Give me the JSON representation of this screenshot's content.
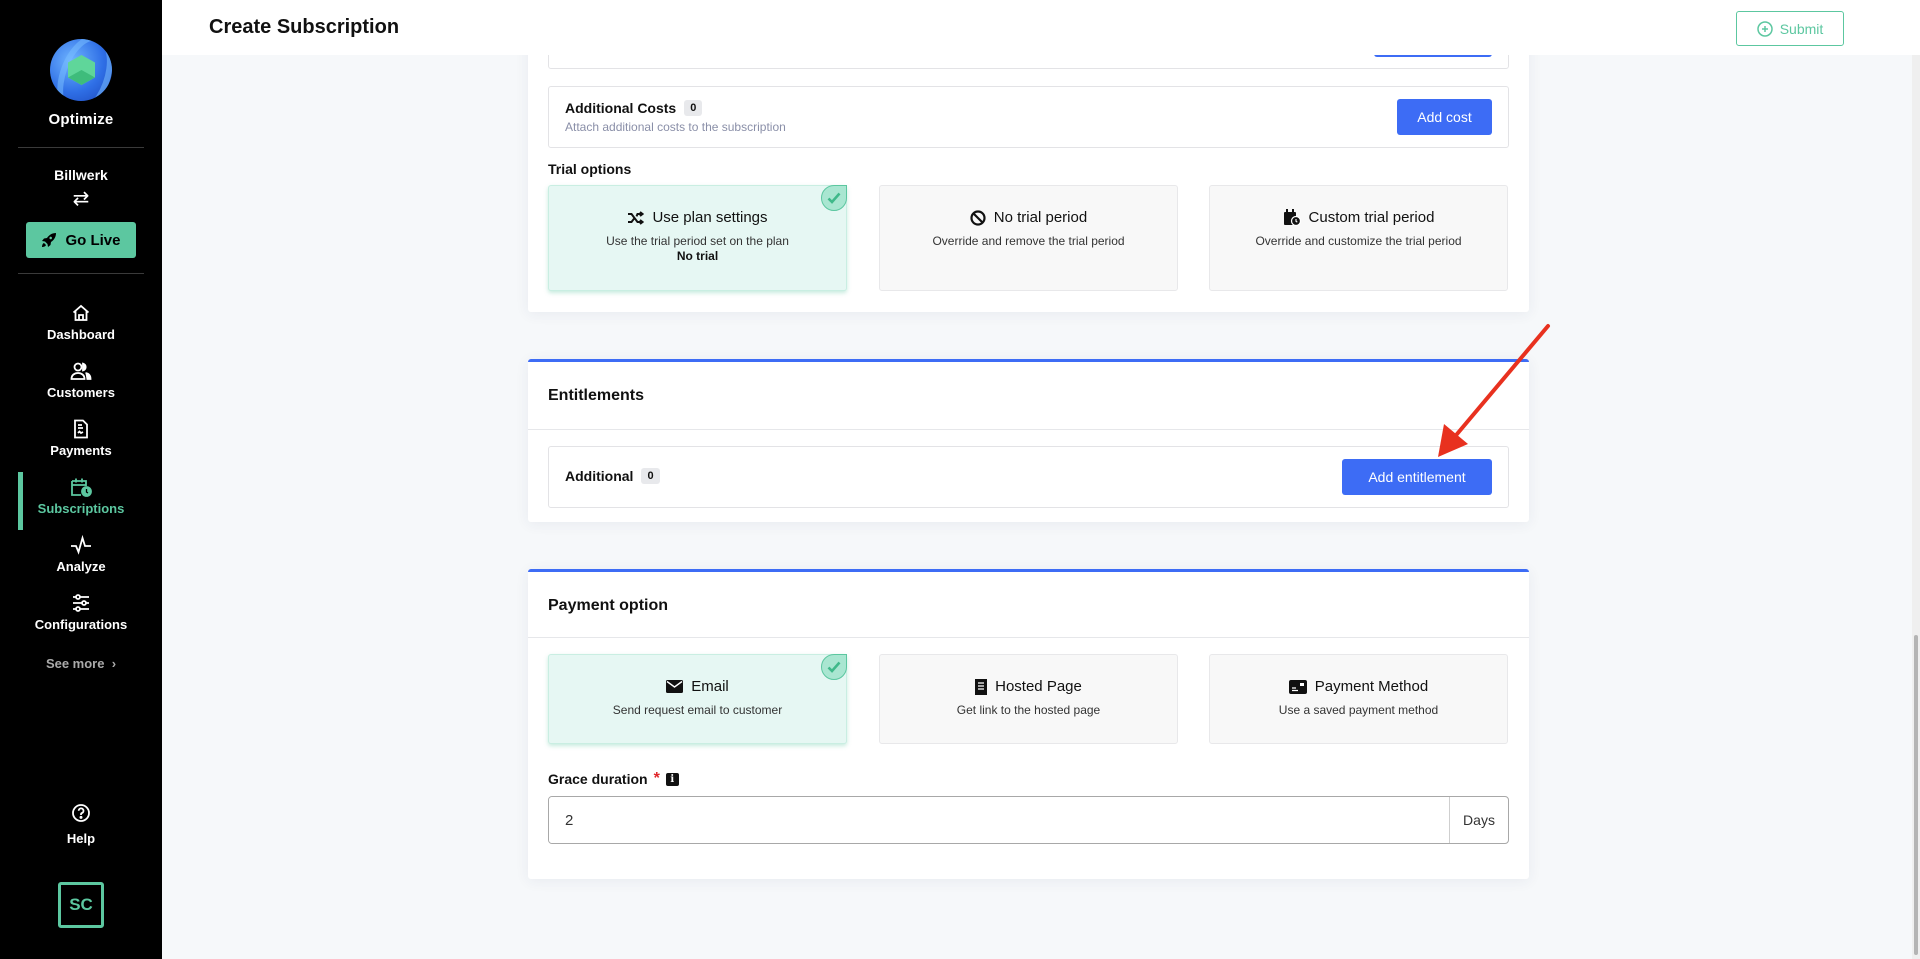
{
  "sidebar": {
    "brand": "Optimize",
    "environment": "Billwerk",
    "switch_icon": "swap-arrows-icon",
    "go_live_label": "Go Live",
    "items": [
      {
        "label": "Dashboard",
        "icon": "home-icon",
        "active": false
      },
      {
        "label": "Customers",
        "icon": "users-icon",
        "active": false
      },
      {
        "label": "Payments",
        "icon": "invoice-icon",
        "active": false
      },
      {
        "label": "Subscriptions",
        "icon": "calendar-clock-icon",
        "active": true
      },
      {
        "label": "Analyze",
        "icon": "pulse-icon",
        "active": false
      },
      {
        "label": "Configurations",
        "icon": "sliders-icon",
        "active": false
      }
    ],
    "see_more_label": "See more",
    "help_label": "Help",
    "avatar_initials": "SC"
  },
  "header": {
    "title": "Create Subscription",
    "submit_label": "Submit"
  },
  "additional_costs": {
    "title": "Additional Costs",
    "count": "0",
    "description": "Attach additional costs to the subscription",
    "button_label": "Add cost"
  },
  "trial_options": {
    "label": "Trial options",
    "options": [
      {
        "title": "Use plan settings",
        "icon": "shuffle-icon",
        "description": "Use the trial period set on the plan",
        "extra": "No trial",
        "selected": true
      },
      {
        "title": "No trial period",
        "icon": "ban-icon",
        "description": "Override and remove the trial period",
        "extra": "",
        "selected": false
      },
      {
        "title": "Custom trial period",
        "icon": "calendar-clock-icon",
        "description": "Override and customize the trial period",
        "extra": "",
        "selected": false
      }
    ]
  },
  "entitlements": {
    "title": "Entitlements",
    "row_label": "Additional",
    "count": "0",
    "button_label": "Add entitlement"
  },
  "payment_option": {
    "title": "Payment option",
    "options": [
      {
        "title": "Email",
        "icon": "envelope-icon",
        "description": "Send request email to customer",
        "selected": true
      },
      {
        "title": "Hosted Page",
        "icon": "receipt-icon",
        "description": "Get link to the hosted page",
        "selected": false
      },
      {
        "title": "Payment Method",
        "icon": "credit-card-icon",
        "description": "Use a saved payment method",
        "selected": false
      }
    ],
    "grace_duration": {
      "label": "Grace duration",
      "required_mark": "*",
      "value": "2",
      "unit": "Days"
    }
  },
  "colors": {
    "accent_green": "#5cc7a0",
    "primary_blue": "#3d6cf5",
    "annotation_arrow": "#e8311f"
  }
}
